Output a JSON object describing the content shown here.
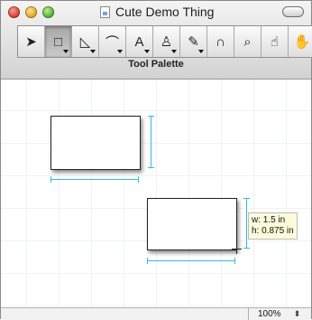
{
  "window": {
    "title": "Cute Demo Thing"
  },
  "toolbar": {
    "label": "Tool Palette",
    "tools": [
      {
        "name": "arrow-tool",
        "icon": "arrow-icon",
        "glyph": "➤",
        "selected": false,
        "has_menu": false
      },
      {
        "name": "rectangle-tool",
        "icon": "rectangle-icon",
        "glyph": "□",
        "selected": true,
        "has_menu": true
      },
      {
        "name": "triangle-tool",
        "icon": "triangle-icon",
        "glyph": "◺",
        "selected": false,
        "has_menu": true
      },
      {
        "name": "curve-tool",
        "icon": "curve-icon",
        "glyph": "⌒",
        "selected": false,
        "has_menu": true
      },
      {
        "name": "text-tool",
        "icon": "text-icon",
        "glyph": "A",
        "selected": false,
        "has_menu": true
      },
      {
        "name": "stamp-tool",
        "icon": "stamp-icon",
        "glyph": "♙",
        "selected": false,
        "has_menu": true
      },
      {
        "name": "brush-tool",
        "icon": "brush-icon",
        "glyph": "✎",
        "selected": false,
        "has_menu": true
      },
      {
        "name": "magnet-tool",
        "icon": "magnet-icon",
        "glyph": "∩",
        "selected": false,
        "has_menu": false
      },
      {
        "name": "zoom-tool",
        "icon": "magnifier-icon",
        "glyph": "⌕",
        "selected": false,
        "has_menu": false
      },
      {
        "name": "pointer-hand-tool",
        "icon": "pointing-hand-icon",
        "glyph": "☝",
        "selected": false,
        "has_menu": false
      },
      {
        "name": "grab-hand-tool",
        "icon": "grab-hand-icon",
        "glyph": "✋",
        "selected": false,
        "has_menu": false
      }
    ]
  },
  "canvas": {
    "tooltip": {
      "width": "w: 1.5 in",
      "height": "h: 0.875 in"
    }
  },
  "status": {
    "zoom": "100%"
  },
  "colors": {
    "dimension_lines": "#35b7ea",
    "tooltip_bg": "#fbfbda",
    "grid": "#eef2f6"
  }
}
